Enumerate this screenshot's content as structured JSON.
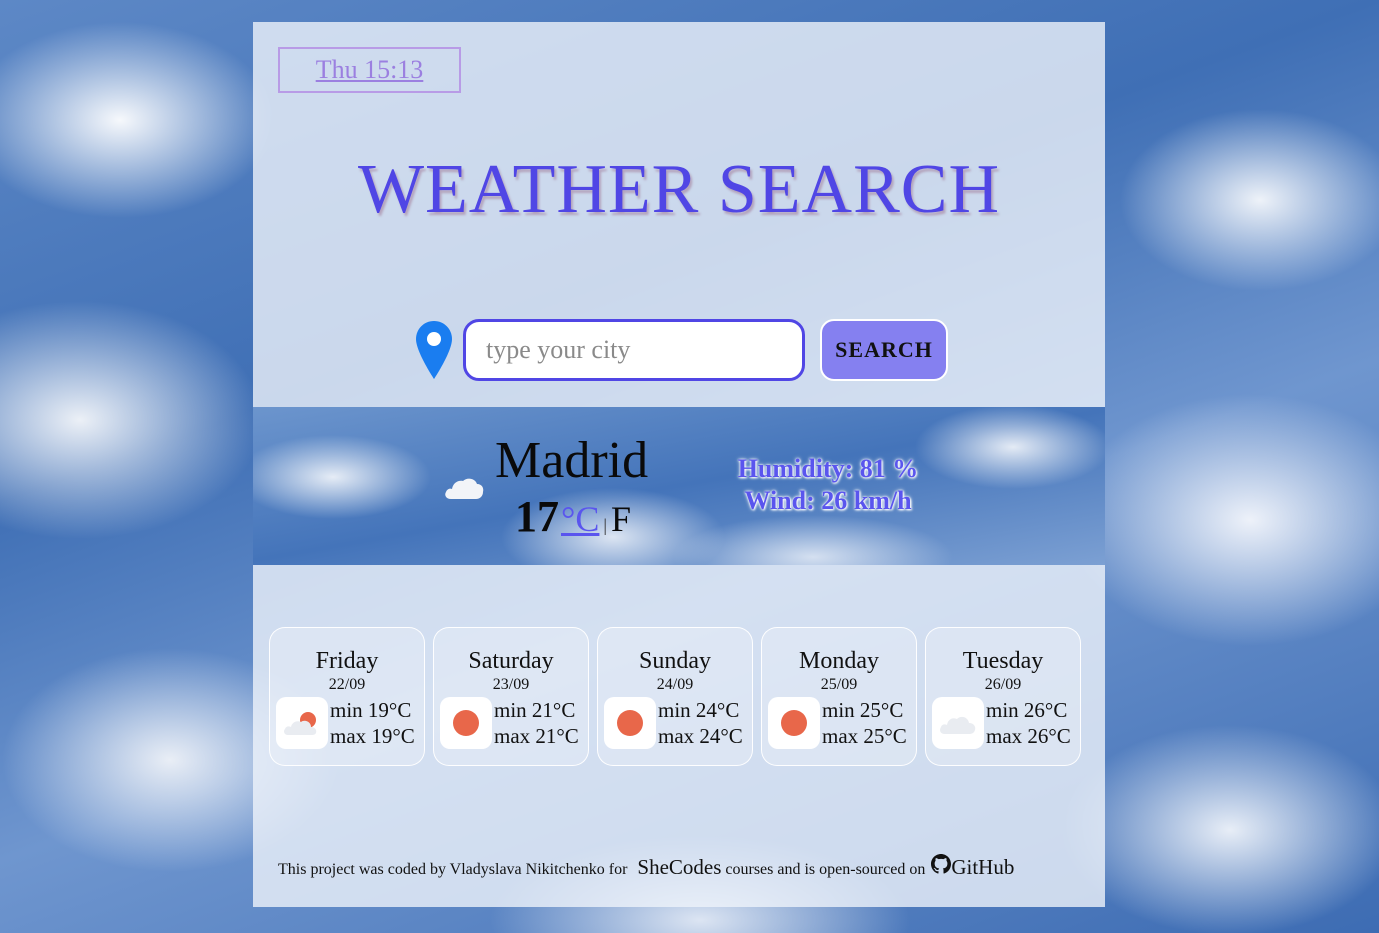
{
  "header": {
    "datetime": "Thu 15:13",
    "title": "WEATHER SEARCH"
  },
  "search": {
    "placeholder": "type your city",
    "value": "",
    "button_label": "SEARCH",
    "icon": "location-pin-icon"
  },
  "current": {
    "city": "Madrid",
    "temperature": "17",
    "unit_celsius": "°C",
    "unit_separator": "|",
    "unit_fahrenheit": "F",
    "humidity": "Humidity: 81 %",
    "wind": "Wind: 26 km/h",
    "icon": "cloud-icon"
  },
  "forecast": [
    {
      "day": "Friday",
      "date": "22/09",
      "min": "min 19°C",
      "max": "max 19°C",
      "icon": "partly-cloudy-icon"
    },
    {
      "day": "Saturday",
      "date": "23/09",
      "min": "min 21°C",
      "max": "max 21°C",
      "icon": "sun-icon"
    },
    {
      "day": "Sunday",
      "date": "24/09",
      "min": "min 24°C",
      "max": "max 24°C",
      "icon": "sun-icon"
    },
    {
      "day": "Monday",
      "date": "25/09",
      "min": "min 25°C",
      "max": "max 25°C",
      "icon": "sun-icon"
    },
    {
      "day": "Tuesday",
      "date": "26/09",
      "min": "min 26°C",
      "max": "max 26°C",
      "icon": "cloud-icon"
    }
  ],
  "footer": {
    "text_1": "This project was coded by Vladyslava Nikitchenko for",
    "link_shecodes": "SheCodes",
    "text_2": "courses and is open-sourced on",
    "link_github": "GitHub"
  },
  "colors": {
    "accent": "#5046e5",
    "button": "#8580f0",
    "sun": "#e8674a",
    "date_border": "#b89be6"
  }
}
